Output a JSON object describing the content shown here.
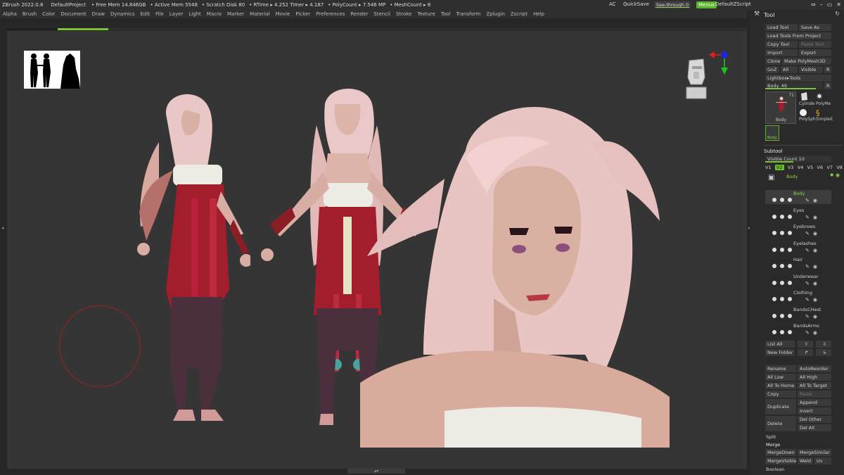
{
  "titlebar": {
    "app": "ZBrush 2022.0.8",
    "project": "DefaultProject",
    "stats": [
      "• Free Mem 14.846GB",
      "• Active Mem 5548",
      "• Scratch Disk 80",
      "• RTime ▸ 4.252 Timer ▸ 4.187",
      "• PolyCount ▸ 7.546 MP",
      "• MeshCount ▸ 8"
    ],
    "ac": "AC",
    "quicksave": "QuickSave",
    "see_through": "See-through  0",
    "menus": "Menus",
    "zscript": "DefaultZScript"
  },
  "menubar": [
    "Alpha",
    "Brush",
    "Color",
    "Document",
    "Draw",
    "Dynamics",
    "Edit",
    "File",
    "Layer",
    "Light",
    "Macro",
    "Marker",
    "Material",
    "Movie",
    "Picker",
    "Preferences",
    "Render",
    "Stencil",
    "Stroke",
    "Texture",
    "Tool",
    "Transform",
    "Zplugin",
    "Zscript",
    "Help"
  ],
  "tool_panel": {
    "title": "Tool",
    "load_tool": "Load Tool",
    "save_as": "Save As",
    "load_from_project": "Load Tools From Project",
    "copy_tool": "Copy Tool",
    "paste_tool": "Paste Tool",
    "import": "Import",
    "export": "Export",
    "clone": "Clone",
    "make_polymesh": "Make PolyMesh3D",
    "goz": "GoZ",
    "all": "All",
    "visible": "Visible",
    "r": "R",
    "lightbox_tools": "Lightbox▸Tools",
    "body_slider": "Body. 49",
    "thumb_count": "71",
    "thumb_label": "Body",
    "cylinder": "Cylinde",
    "polymesh": "PolyMe",
    "polysphere": "PolySph",
    "simplebrush": "SimpleE",
    "body_small": "Body"
  },
  "subtool": {
    "title": "Subtool",
    "visible_count": "Visible Count 10",
    "tabs": [
      "V1",
      "V2",
      "V3",
      "V4",
      "V5",
      "V6",
      "V7",
      "V8"
    ],
    "active_tab": "V2",
    "items": [
      {
        "name": "Body",
        "selected": true
      },
      {
        "name": "Eyes",
        "selected": false
      },
      {
        "name": "Eyebrows",
        "selected": false
      },
      {
        "name": "Eyelashes",
        "selected": false
      },
      {
        "name": "Hair",
        "selected": false
      },
      {
        "name": "Underwear",
        "selected": false
      },
      {
        "name": "Clothing",
        "selected": false
      },
      {
        "name": "BandsCHest",
        "selected": false
      },
      {
        "name": "BandsArms",
        "selected": false
      }
    ],
    "header_body": "Body",
    "list_all": "List All",
    "new_folder": "New Folder",
    "rename": "Rename",
    "auto_reorder": "AutoReorder",
    "all_low": "All Low",
    "all_high": "All High",
    "all_to_home": "All To Home",
    "all_to_target": "All To Target",
    "copy": "Copy",
    "paste": "Paste",
    "duplicate": "Duplicate",
    "append": "Append",
    "insert": "Insert",
    "delete": "Delete",
    "del_other": "Del Other",
    "del_all": "Del All",
    "split": "Split",
    "merge": "Merge",
    "merge_down": "MergeDown",
    "merge_similar": "MergeSimilar",
    "merge_visible": "MergeVisible",
    "weld": "Weld",
    "uv": "Uv",
    "boolean": "Boolean"
  },
  "colors": {
    "accent_green": "#7bc33a",
    "viewport_bg": "#353535",
    "panel_bg": "#2a2a2a",
    "brush_circle": "#9d2020"
  }
}
